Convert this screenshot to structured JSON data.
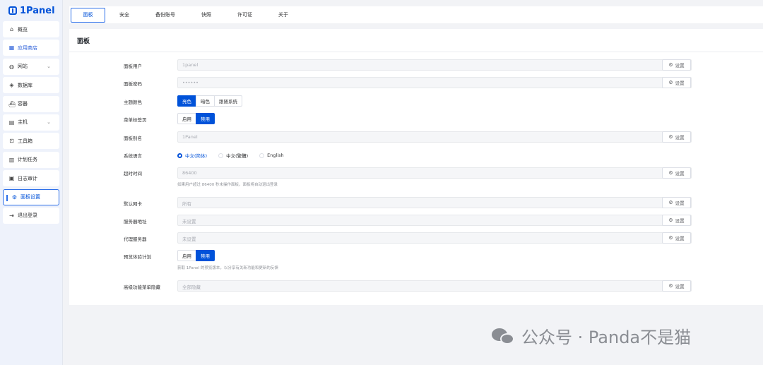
{
  "app": {
    "logo_text": "1Panel"
  },
  "sidebar": {
    "items": [
      {
        "label": "概览",
        "icon": "home-icon"
      },
      {
        "label": "应用商店",
        "icon": "apps-grid-icon"
      },
      {
        "label": "网站",
        "icon": "globe-icon"
      },
      {
        "label": "数据库",
        "icon": "database-icon"
      },
      {
        "label": "容器",
        "icon": "container-icon"
      },
      {
        "label": "主机",
        "icon": "host-icon"
      },
      {
        "label": "工具箱",
        "icon": "toolbox-icon"
      },
      {
        "label": "计划任务",
        "icon": "tasks-icon"
      },
      {
        "label": "日志审计",
        "icon": "log-icon"
      },
      {
        "label": "面板设置",
        "icon": "gear-icon"
      },
      {
        "label": "退出登录",
        "icon": "logout-icon"
      }
    ]
  },
  "tabs": [
    "面板",
    "安全",
    "备份账号",
    "快照",
    "许可证",
    "关于"
  ],
  "panel": {
    "title": "面板",
    "set_label": "设置",
    "user": {
      "label": "面板用户",
      "value": "1panel"
    },
    "password": {
      "label": "面板密码",
      "value": "••••••"
    },
    "theme": {
      "label": "主题颜色",
      "options": [
        "亮色",
        "暗色",
        "跟随系统"
      ],
      "selected": "亮色"
    },
    "menu_tabs": {
      "label": "菜单标签页",
      "options": [
        "启用",
        "禁用"
      ],
      "selected": "禁用"
    },
    "alias": {
      "label": "面板别名",
      "value": "1Panel"
    },
    "language": {
      "label": "系统语言",
      "options": [
        "中文(简体)",
        "中文(繁體)",
        "English"
      ],
      "selected": "中文(简体)"
    },
    "timeout": {
      "label": "超时时间",
      "value": "86400",
      "hint": "如果用户超过 86400 秒未操作面板，面板将自动退出登录"
    },
    "nic": {
      "label": "默认网卡",
      "value": "所有"
    },
    "server_addr": {
      "label": "服务器地址",
      "value": "未设置"
    },
    "proxy": {
      "label": "代理服务器",
      "value": "未设置"
    },
    "preview": {
      "label": "预览体验计划",
      "options": [
        "启用",
        "禁用"
      ],
      "selected": "禁用",
      "hint": "获取 1Panel 的预览版本，以分享有关新功能和更新的反馈"
    },
    "advanced": {
      "label": "高级功能菜单隐藏",
      "value": "全部隐藏"
    }
  },
  "watermark": {
    "text": "公众号 · Panda不是猫"
  },
  "colors": {
    "primary": "#0052d9",
    "sidebar_bg": "#eef2fb",
    "page_bg": "#f2f3f6"
  }
}
